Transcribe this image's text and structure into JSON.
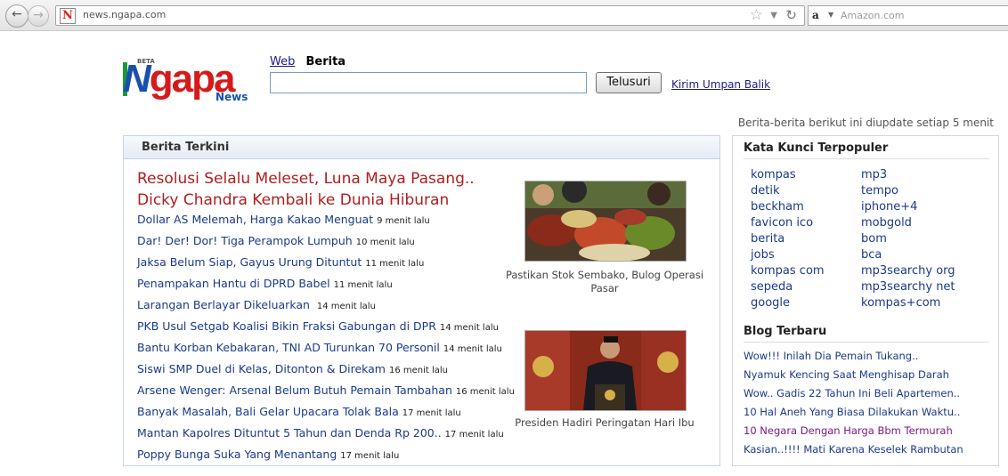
{
  "browser": {
    "url": "news.ngapa.com",
    "search_placeholder": "Amazon.com"
  },
  "logo": {
    "beta": "BETA",
    "first": "N",
    "rest": "gapa",
    "sub": "News"
  },
  "search": {
    "tab_web": "Web",
    "tab_berita": "Berita",
    "input_value": "",
    "button_label": "Telusuri",
    "feedback_link": "Kirim Umpan Balik"
  },
  "update_note": "Berita-berita berikut ini diupdate setiap 5 menit",
  "main": {
    "header": "Berita Terkini",
    "headline_1": "Resolusi Selalu Meleset, Luna Maya Pasang..",
    "headline_2": "Dicky Chandra Kembali ke Dunia Hiburan",
    "news": [
      {
        "title": "Dollar AS Melemah, Harga Kakao Menguat",
        "time": "9 menit lalu"
      },
      {
        "title": "Dar! Der! Dor! Tiga Perampok Lumpuh",
        "time": "10 menit lalu"
      },
      {
        "title": "Jaksa Belum Siap, Gayus Urung Dituntut",
        "time": "11 menit lalu"
      },
      {
        "title": "Penampakan Hantu di DPRD Babel",
        "time": "11 menit lalu"
      },
      {
        "title": "Larangan Berlayar Dikeluarkan",
        "time": "14 menit lalu"
      },
      {
        "title": "PKB Usul Setgab Koalisi Bikin Fraksi Gabungan di DPR",
        "time": "14 menit lalu"
      },
      {
        "title": "Bantu Korban Kebakaran, TNI AD Turunkan 70 Personil",
        "time": "14 menit lalu"
      },
      {
        "title": "Siswi SMP Duel di Kelas, Ditonton & Direkam",
        "time": "16 menit lalu"
      },
      {
        "title": "Arsene Wenger: Arsenal Belum Butuh Pemain Tambahan",
        "time": "16 menit lalu"
      },
      {
        "title": "Banyak Masalah, Bali Gelar Upacara Tolak Bala",
        "time": "17 menit lalu"
      },
      {
        "title": "Mantan Kapolres Dituntut 5 Tahun dan Denda Rp 200..",
        "time": "17 menit lalu"
      },
      {
        "title": "Poppy Bunga Suka Yang Menantang",
        "time": "17 menit lalu"
      }
    ],
    "photo_1_caption_1": "Pastikan Stok Sembako, Bulog Operasi",
    "photo_1_caption_2": "Pasar",
    "photo_2_caption": "Presiden Hadiri Peringatan Hari Ibu"
  },
  "side": {
    "keywords_title": "Kata Kunci Terpopuler",
    "keywords_left": [
      "kompas",
      "detik",
      "beckham",
      "favicon ico",
      "berita",
      "jobs",
      "kompas com",
      "sepeda",
      "google"
    ],
    "keywords_right": [
      "mp3",
      "tempo",
      "iphone+4",
      "mobgold",
      "bom",
      "bca",
      "mp3searchy org",
      "mp3searchy net",
      "kompas+com"
    ],
    "blog_title": "Blog Terbaru",
    "blog": [
      "Wow!!! Inilah Dia Pemain Tukang..",
      "Nyamuk Kencing Saat Menghisap Darah",
      "Wow.. Gadis 22 Tahun Ini Beli Apartemen..",
      "10 Hal Aneh Yang Biasa Dilakukan Waktu..",
      "10 Negara Dengan Harga Bbm Termurah",
      "Kasian..!!!! Mati Karena Keselek Rambutan"
    ]
  }
}
